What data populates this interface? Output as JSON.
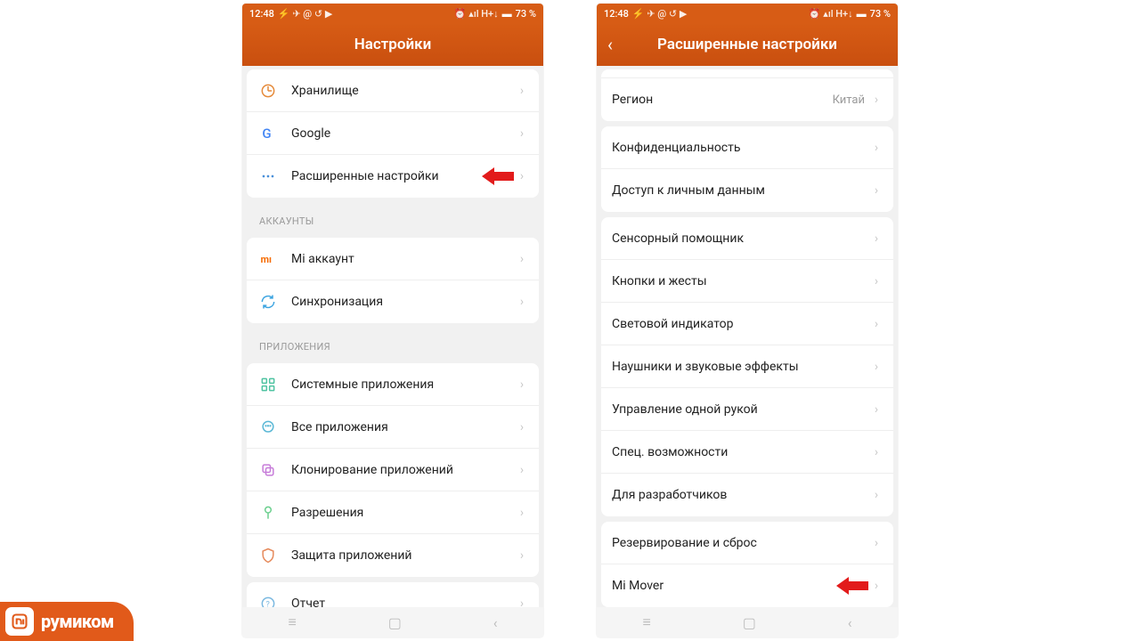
{
  "status": {
    "time": "12:48",
    "left_icons": "⚡ ✈ @ ↺ ▶",
    "right_icons": "⏰ ▴ıl H+↓",
    "battery": "73 %"
  },
  "left": {
    "title": "Настройки",
    "groups": [
      {
        "rows": [
          {
            "icon": "storage",
            "label": "Хранилище"
          },
          {
            "icon": "google",
            "label": "Google"
          },
          {
            "icon": "dots",
            "label": "Расширенные настройки",
            "arrow": true
          }
        ]
      }
    ],
    "section_accounts": "АККАУНТЫ",
    "accounts": [
      {
        "icon": "mi",
        "label": "Mi аккаунт"
      },
      {
        "icon": "sync",
        "label": "Синхронизация"
      }
    ],
    "section_apps": "ПРИЛОЖЕНИЯ",
    "apps": [
      {
        "icon": "grid",
        "label": "Системные приложения"
      },
      {
        "icon": "bubble",
        "label": "Все приложения"
      },
      {
        "icon": "clone",
        "label": "Клонирование приложений"
      },
      {
        "icon": "perm",
        "label": "Разрешения"
      },
      {
        "icon": "shield",
        "label": "Защита приложений"
      }
    ],
    "report": {
      "icon": "help",
      "label": "Отчет"
    }
  },
  "right": {
    "title": "Расширенные настройки",
    "region_label": "Регион",
    "region_value": "Китай",
    "rows1": [
      "Конфиденциальность",
      "Доступ к личным данным"
    ],
    "rows2": [
      "Сенсорный помощник",
      "Кнопки и жесты",
      "Световой индикатор",
      "Наушники и звуковые эффекты",
      "Управление одной рукой",
      "Спец. возможности",
      "Для разработчиков"
    ],
    "rows3": [
      {
        "label": "Резервирование и сброс"
      },
      {
        "label": "Mi Mover",
        "arrow": true
      }
    ]
  },
  "nav": {
    "recent": "≡",
    "home": "▢",
    "back": "‹"
  },
  "logo": "румиком"
}
